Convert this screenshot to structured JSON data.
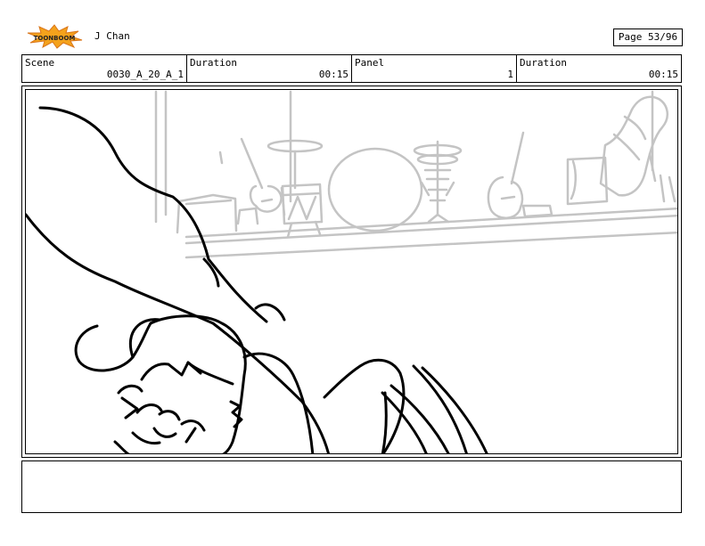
{
  "header": {
    "logo_text": "TOONBOOM",
    "author": "J Chan",
    "page": "Page 53/96"
  },
  "info": {
    "scene_label": "Scene",
    "scene_value": "0030_A_20_A_1",
    "duration_label": "Duration",
    "duration_value": "00:15",
    "panel_label": "Panel",
    "panel_value": "1",
    "duration2_label": "Duration",
    "duration2_value": "00:15"
  },
  "notes": {
    "text": ""
  }
}
